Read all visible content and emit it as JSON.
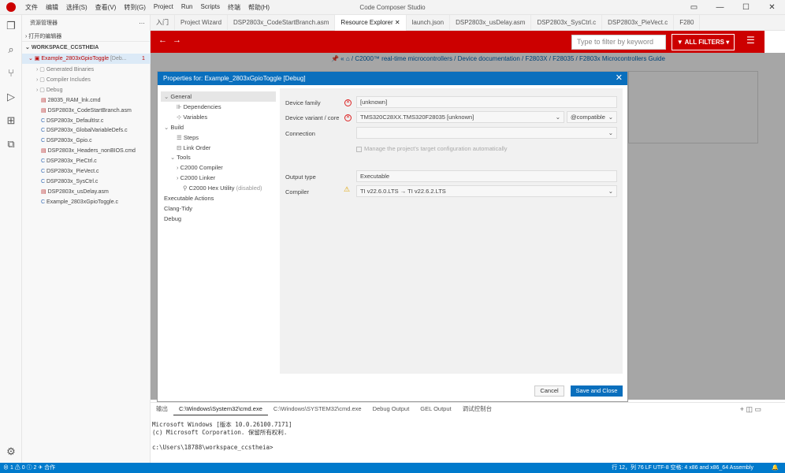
{
  "titlebar": {
    "app_title": "Code Composer Studio",
    "menu": [
      "文件",
      "编辑",
      "选择(S)",
      "查看(V)",
      "转到(G)",
      "Project",
      "Run",
      "Scripts",
      "终端",
      "帮助(H)"
    ]
  },
  "sidebar": {
    "explorer_title": "资源管理器",
    "open_editors": "打开的编辑器",
    "workspace": "WORKSPACE_CCSTHEIA",
    "project": "Example_2803xGpioToggle",
    "project_suffix": "[Deb...",
    "project_badge": "1",
    "items": [
      "Generated Binaries",
      "Compiler Includes",
      "Debug",
      "28035_RAM_lnk.cmd",
      "DSP2803x_CodeStartBranch.asm",
      "DSP2803x_DefaultIsr.c",
      "DSP2803x_GlobalVariableDefs.c",
      "DSP2803x_Gpio.c",
      "DSP2803x_Headers_nonBIOS.cmd",
      "DSP2803x_PieCtrl.c",
      "DSP2803x_PieVect.c",
      "DSP2803x_SysCtrl.c",
      "DSP2803x_usDelay.asm",
      "Example_2803xGpioToggle.c"
    ]
  },
  "tabs": [
    {
      "label": "入门",
      "active": false
    },
    {
      "label": "Project Wizard",
      "active": false
    },
    {
      "label": "DSP2803x_CodeStartBranch.asm",
      "active": false
    },
    {
      "label": "Resource Explorer",
      "active": true
    },
    {
      "label": "launch.json",
      "active": false
    },
    {
      "label": "DSP2803x_usDelay.asm",
      "active": false
    },
    {
      "label": "DSP2803x_SysCtrl.c",
      "active": false
    },
    {
      "label": "DSP2803x_PieVect.c",
      "active": false
    },
    {
      "label": "F280",
      "active": false
    }
  ],
  "resource": {
    "filter_placeholder": "Type to filter by keyword",
    "filters_btn": "ALL FILTERS",
    "breadcrumb": [
      "C2000™ real-time microcontrollers",
      "Device documentation",
      "F2803X",
      "F28035",
      "F2803x Microcontrollers Guide"
    ]
  },
  "dialog": {
    "title": "Properties for: Example_2803xGpioToggle [Debug]",
    "tree": [
      {
        "label": "General",
        "indent": 0,
        "sel": true,
        "icon": "chevron-down"
      },
      {
        "label": "Dependencies",
        "indent": 2,
        "sel": false,
        "icon": "dep"
      },
      {
        "label": "Variables",
        "indent": 2,
        "sel": false,
        "icon": "var"
      },
      {
        "label": "Build",
        "indent": 0,
        "sel": false,
        "icon": "chevron-down"
      },
      {
        "label": "Steps",
        "indent": 2,
        "sel": false,
        "icon": "steps"
      },
      {
        "label": "Link Order",
        "indent": 2,
        "sel": false,
        "icon": "link"
      },
      {
        "label": "Tools",
        "indent": 1,
        "sel": false,
        "icon": "chevron-down"
      },
      {
        "label": "C2000 Compiler",
        "indent": 2,
        "sel": false,
        "icon": "chevron-right"
      },
      {
        "label": "C2000 Linker",
        "indent": 2,
        "sel": false,
        "icon": "chevron-right"
      },
      {
        "label": "C2000 Hex Utility",
        "indent": 3,
        "sel": false,
        "icon": "wrench",
        "suffix": "(disabled)"
      },
      {
        "label": "Executable Actions",
        "indent": 0,
        "sel": false,
        "icon": ""
      },
      {
        "label": "Clang-Tidy",
        "indent": 0,
        "sel": false,
        "icon": ""
      },
      {
        "label": "Debug",
        "indent": 0,
        "sel": false,
        "icon": ""
      }
    ],
    "device_family_label": "Device family",
    "device_family_value": "[unknown]",
    "device_variant_label": "Device variant / core",
    "device_variant_value": "TMS320C28XX.TMS320F28035 [unknown]",
    "compat_value": "@compatible",
    "connection_label": "Connection",
    "connection_value": "",
    "manage_label": "Manage the project's target configuration automatically",
    "output_type_label": "Output type",
    "output_type_value": "Executable",
    "compiler_label": "Compiler",
    "compiler_value": "TI v22.6.0.LTS → TI v22.6.2.LTS",
    "cancel": "Cancel",
    "save_close": "Save and Close"
  },
  "panel": {
    "tabs": [
      "输出",
      "C:\\Windows\\System32\\cmd.exe",
      "C:\\Windows\\SYSTEM32\\cmd.exe",
      "Debug Output",
      "GEL Output",
      "调试控制台"
    ],
    "lines": [
      "Microsoft Windows [版本 10.0.26100.7171]",
      "(c) Microsoft Corporation. 保留所有权利.",
      "",
      "c:\\Users\\18788\\workspace_ccstheia>"
    ]
  },
  "status": {
    "left": "⊗ 1  ⚠ 0  ⓘ 2  ✈ 合作",
    "right": "行 12，列 76   LF   UTF-8   空格: 4   x86 and x86_64 Assembly"
  }
}
